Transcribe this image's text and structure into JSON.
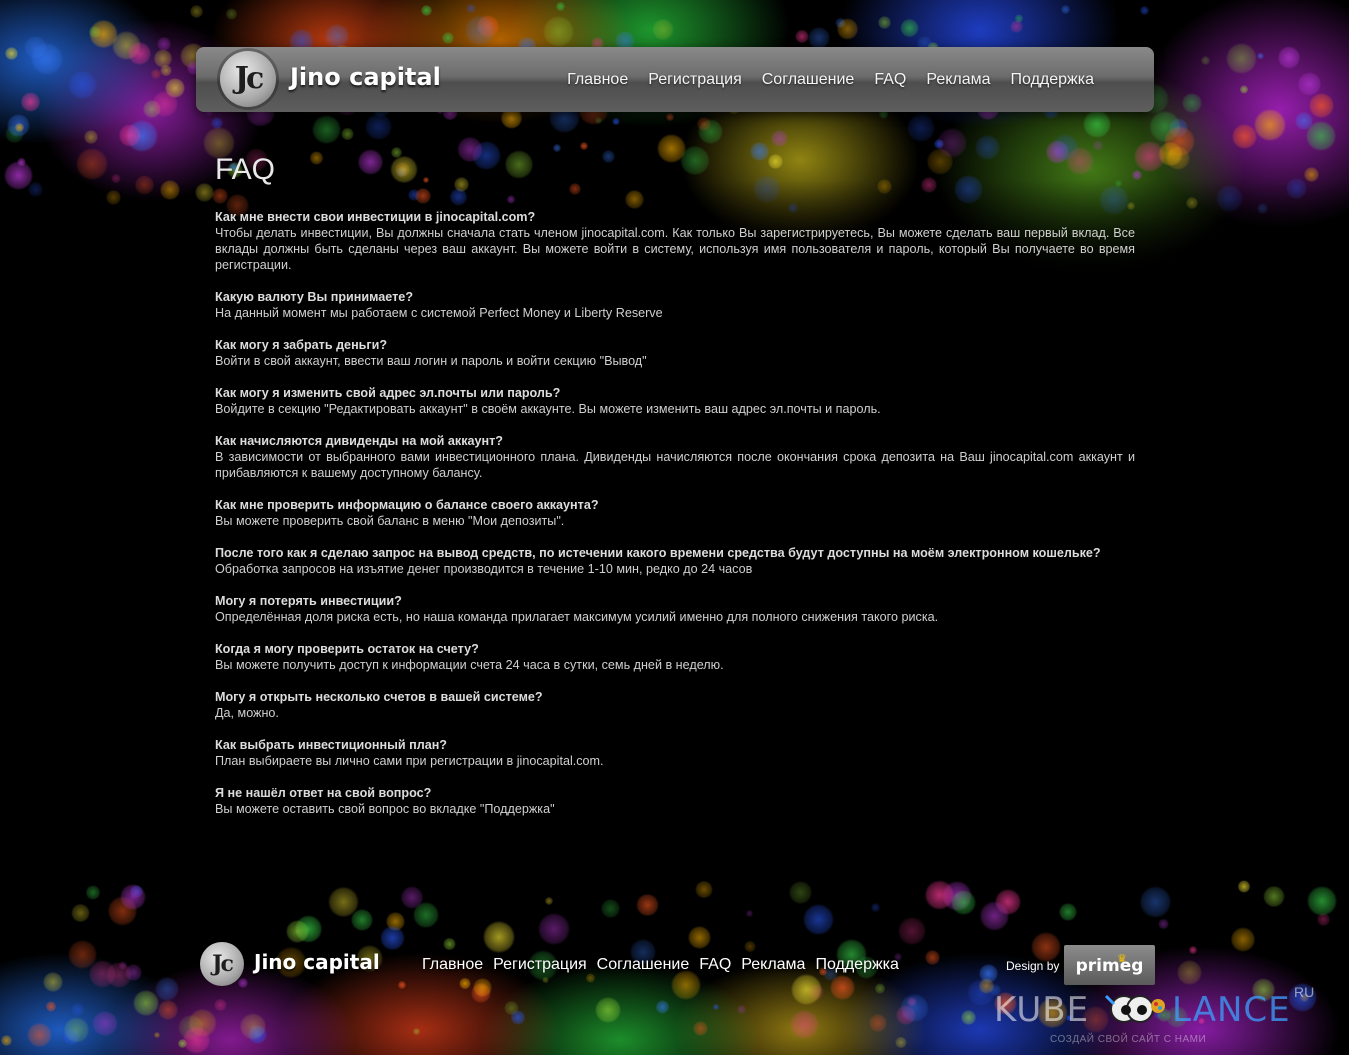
{
  "header": {
    "logo_mark": "Jc",
    "logo_text": "Jino capital",
    "nav": [
      "Главное",
      "Регистрация",
      "Соглашение",
      "FAQ",
      "Реклама",
      "Поддержка"
    ]
  },
  "page_title": "FAQ",
  "faq": [
    {
      "q": "Как мне внести свои инвестиции в jinocapital.com?",
      "a": "Чтобы делать инвестиции, Вы должны сначала стать членом jinocapital.com. Как только Вы зарегистрируетесь, Вы можете сделать ваш первый вклад. Все вклады должны быть сделаны через ваш аккаунт. Вы можете войти в систему, используя имя пользователя и пароль, который Вы получаете во время регистрации."
    },
    {
      "q": "Какую валюту Вы принимаете?",
      "a": "На данный момент мы работаем с системой Perfect Money и Liberty Reserve"
    },
    {
      "q": "Как могу я забрать деньги?",
      "a": "Войти в свой аккаунт, ввести ваш логин и пароль и войти секцию \"Вывод\""
    },
    {
      "q": "Как могу я изменить свой адрес эл.почты или пароль?",
      "a": "Войдите в секцию \"Редактировать аккаунт\" в своём аккаунте. Вы можете изменить ваш адрес эл.почты и пароль."
    },
    {
      "q": "Как начисляются дивиденды на мой аккаунт?",
      "a": "В зависимости от выбранного вами инвестиционного плана. Дивиденды начисляются после окончания срока депозита на Ваш jinocapital.com аккаунт и прибавляются к вашему доступному балансу."
    },
    {
      "q": "Как мне проверить информацию о балансе своего аккаунта?",
      "a": "Вы можете проверить свой баланс в меню \"Мои депозиты\"."
    },
    {
      "q": "После того как я сделаю запрос на вывод средств, по истечении какого времени средства будут доступны на моём электронном кошельке?",
      "a": "Обработка запросов на изъятие денег производится в течение 1-10 мин, редко до 24 часов"
    },
    {
      "q": "Могу я потерять инвестиции?",
      "a": "Определённая доля риска есть, но наша команда прилагает максимум усилий именно для полного снижения такого риска."
    },
    {
      "q": "Когда я могу проверить остаток на счету?",
      "a": "Вы можете получить доступ к информации счета 24 часа в сутки, семь дней в неделю."
    },
    {
      "q": "Могу я открыть несколько счетов в вашей системе?",
      "a": "Да, можно."
    },
    {
      "q": "Как выбрать инвестиционный план?",
      "a": "План выбираете вы лично сами при регистрации в jinocapital.com."
    },
    {
      "q": "Я не нашёл ответ на свой вопрос?",
      "a": "Вы можете оставить свой вопрос во вкладке \"Поддержка\""
    }
  ],
  "footer": {
    "logo_mark": "Jc",
    "logo_text": "Jino capital",
    "nav": [
      "Главное",
      "Регистрация",
      "Соглашение",
      "FAQ",
      "Реклама",
      "Поддержка"
    ],
    "design_by": "Design by",
    "designer": "primeg"
  },
  "watermark": {
    "left": "KUBE",
    "right": "LANCE",
    "suffix": "RU",
    "tagline": "СОЗДАЙ СВОЙ САЙТ С НАМИ"
  },
  "colors": {
    "background": "#000000",
    "header_bar": "#6c6c6c",
    "text": "#d6d6d6"
  }
}
